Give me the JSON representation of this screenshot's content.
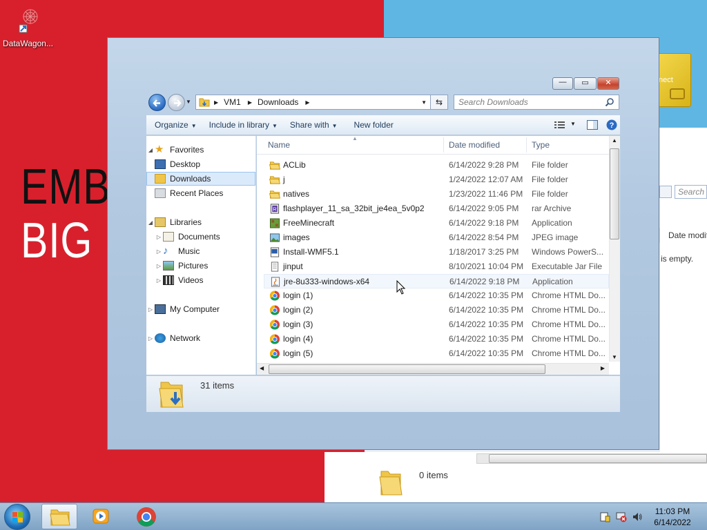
{
  "desktop": {
    "banner_line1": "EMBR",
    "banner_line2": "BIG E",
    "icon_label": "DataWagon...",
    "tile_text": "nect"
  },
  "background_window": {
    "search_placeholder": "Search S",
    "column_date": "Date modifi",
    "empty_text": "is empty.",
    "item_count": "0 items"
  },
  "window": {
    "controls": {
      "minimize": "—",
      "maximize": "▭",
      "close": "✕"
    },
    "breadcrumb": [
      "VM1",
      "Downloads"
    ],
    "search_placeholder": "Search Downloads",
    "toolbar": {
      "organize": "Organize",
      "include": "Include in library",
      "share": "Share with",
      "new_folder": "New folder"
    },
    "nav": {
      "favorites": "Favorites",
      "desktop": "Desktop",
      "downloads": "Downloads",
      "recent": "Recent Places",
      "libraries": "Libraries",
      "documents": "Documents",
      "music": "Music",
      "pictures": "Pictures",
      "videos": "Videos",
      "computer": "My Computer",
      "network": "Network"
    },
    "columns": {
      "name": "Name",
      "date": "Date modified",
      "type": "Type"
    },
    "files": [
      {
        "name": "ACLib",
        "date": "6/14/2022 9:28 PM",
        "type": "File folder",
        "icon": "folder-icon"
      },
      {
        "name": "j",
        "date": "1/24/2022 12:07 AM",
        "type": "File folder",
        "icon": "folder-icon"
      },
      {
        "name": "natives",
        "date": "1/23/2022 11:46 PM",
        "type": "File folder",
        "icon": "folder-icon"
      },
      {
        "name": "flashplayer_11_sa_32bit_je4ea_5v0p2",
        "date": "6/14/2022 9:05 PM",
        "type": "rar Archive",
        "icon": "archive-icon"
      },
      {
        "name": "FreeMinecraft",
        "date": "6/14/2022 9:18 PM",
        "type": "Application",
        "icon": "app-icon"
      },
      {
        "name": "images",
        "date": "6/14/2022 8:54 PM",
        "type": "JPEG image",
        "icon": "image-icon"
      },
      {
        "name": "Install-WMF5.1",
        "date": "1/18/2017 3:25 PM",
        "type": "Windows PowerS...",
        "icon": "script-icon"
      },
      {
        "name": "jinput",
        "date": "8/10/2021 10:04 PM",
        "type": "Executable Jar File",
        "icon": "jar-icon"
      },
      {
        "name": "jre-8u333-windows-x64",
        "date": "6/14/2022 9:18 PM",
        "type": "Application",
        "icon": "java-icon"
      },
      {
        "name": "login (1)",
        "date": "6/14/2022 10:35 PM",
        "type": "Chrome HTML Do...",
        "icon": "chrome-icon"
      },
      {
        "name": "login (2)",
        "date": "6/14/2022 10:35 PM",
        "type": "Chrome HTML Do...",
        "icon": "chrome-icon"
      },
      {
        "name": "login (3)",
        "date": "6/14/2022 10:35 PM",
        "type": "Chrome HTML Do...",
        "icon": "chrome-icon"
      },
      {
        "name": "login (4)",
        "date": "6/14/2022 10:35 PM",
        "type": "Chrome HTML Do...",
        "icon": "chrome-icon"
      },
      {
        "name": "login (5)",
        "date": "6/14/2022 10:35 PM",
        "type": "Chrome HTML Do...",
        "icon": "chrome-icon"
      }
    ],
    "item_count": "31 items"
  },
  "taskbar": {
    "time": "11:03 PM",
    "date": "6/14/2022"
  },
  "colors": {
    "desktop_red": "#d8202d",
    "desktop_blue": "#5fb6e3",
    "selection": "#dbeafb",
    "folder": "#f0c64a"
  }
}
